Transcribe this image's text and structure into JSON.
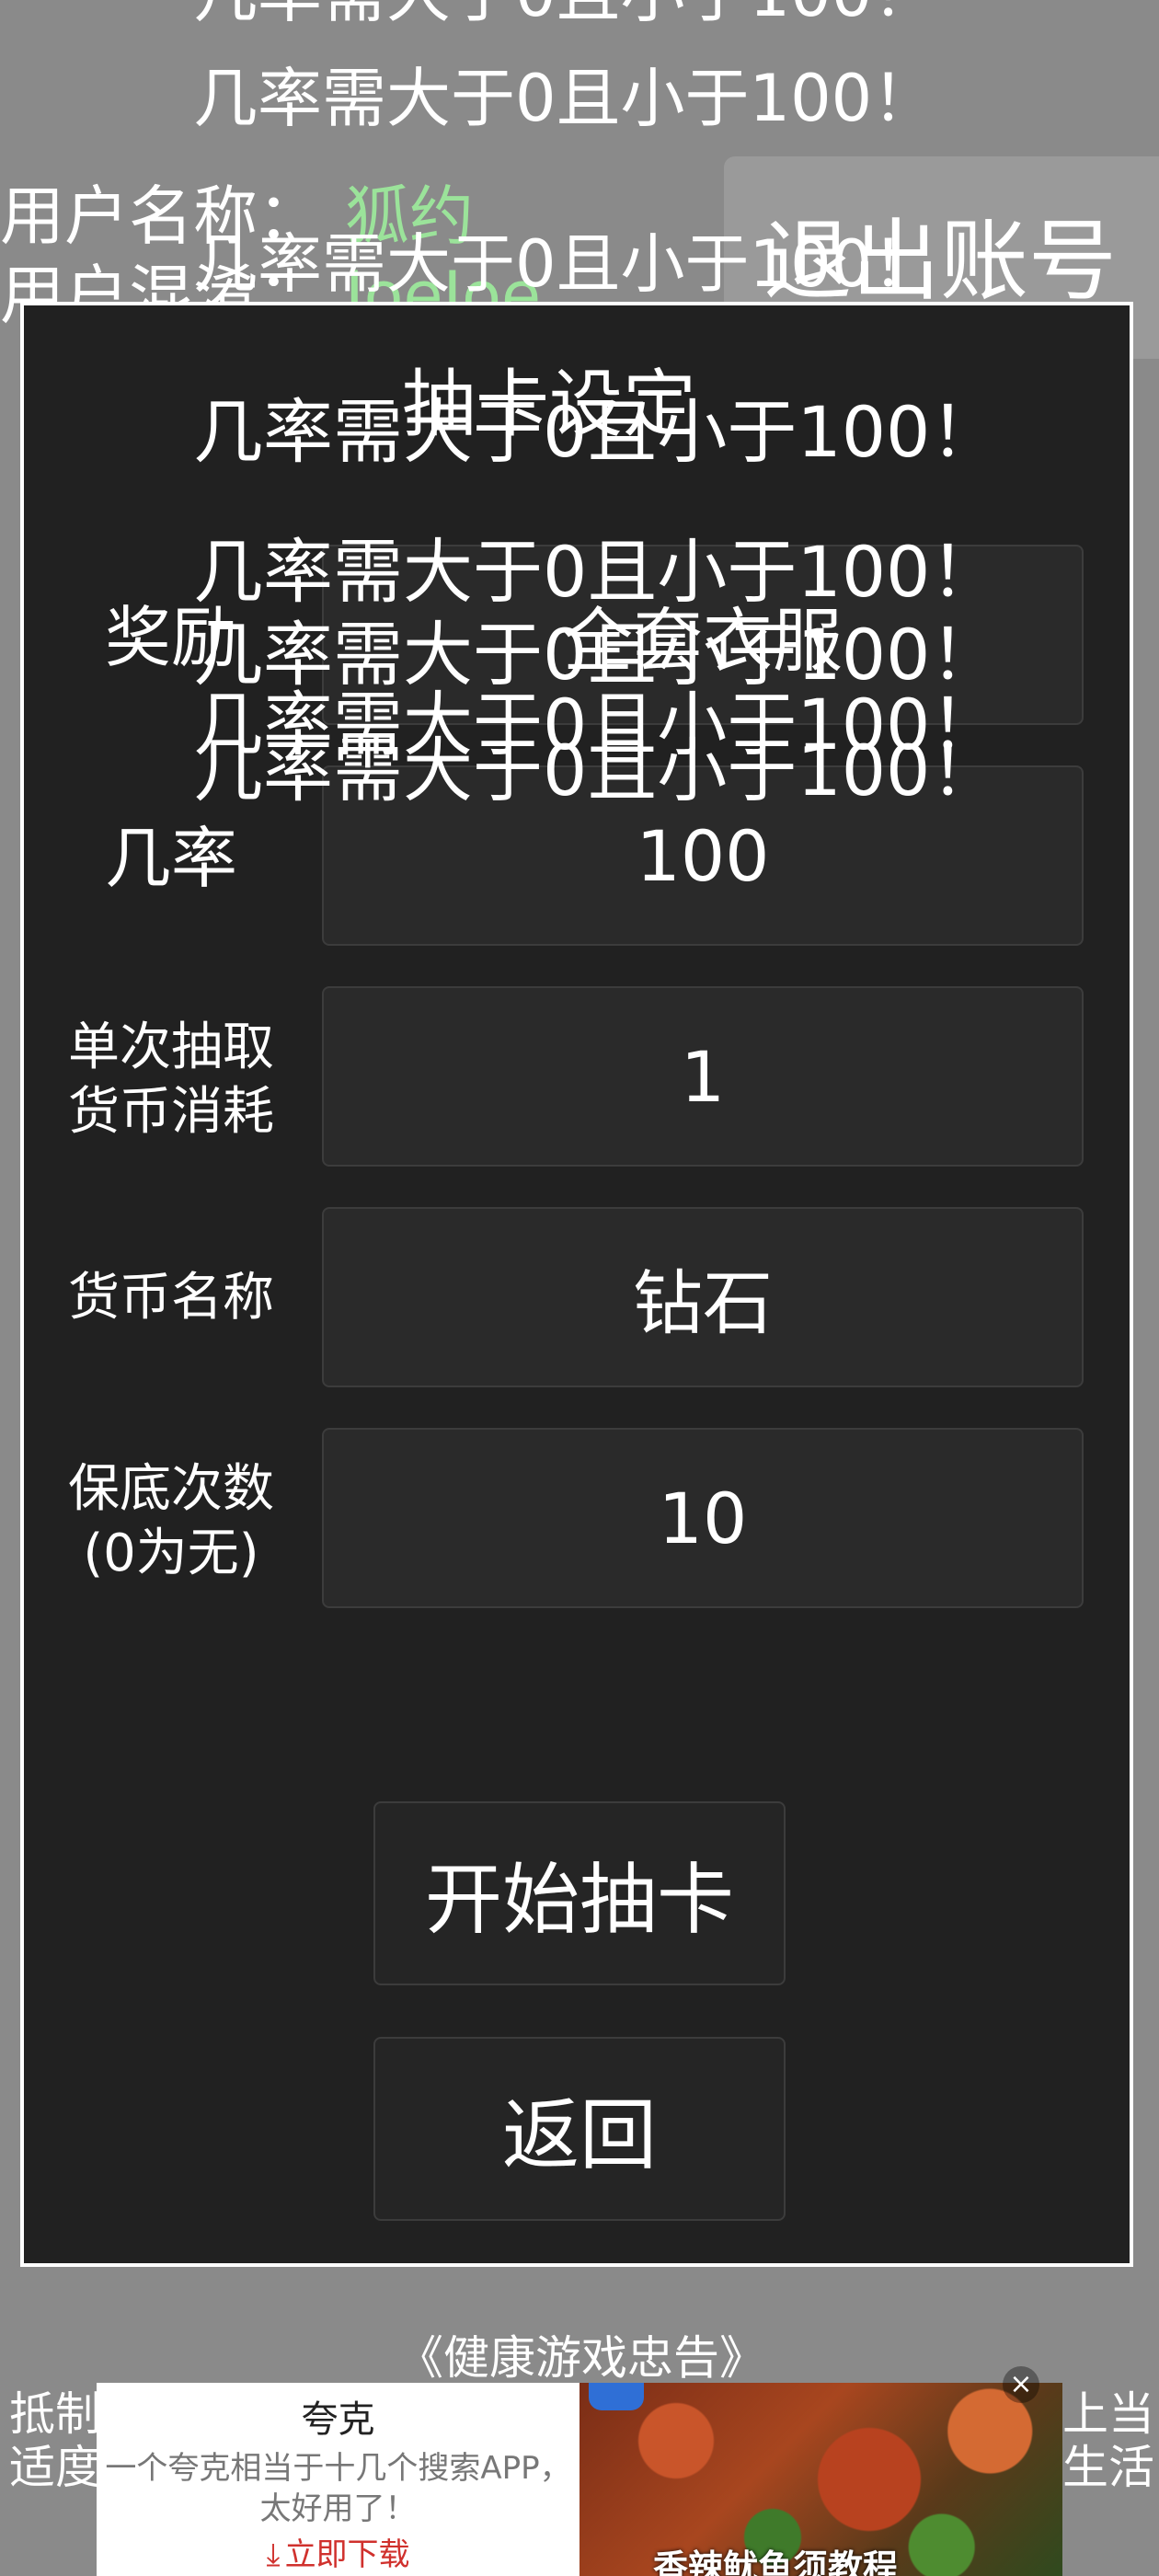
{
  "toast_message": "几率需大于0且小于100！",
  "user": {
    "name_label": "用户名称：",
    "name_value": "狐约",
    "second_label": "用户混淆：",
    "second_value": "JoeJoe"
  },
  "logout_label": "退出账号",
  "dialog": {
    "title": "抽卡设定",
    "fields": [
      {
        "label": "奖励",
        "value": "全套衣服"
      },
      {
        "label": "几率",
        "value": "100"
      },
      {
        "label": "单次抽取\n货币消耗",
        "value": "1"
      },
      {
        "label": "货币名称",
        "value": "钻石"
      },
      {
        "label": "保底次数\n(0为无)",
        "value": "10"
      }
    ],
    "start_button": "开始抽卡",
    "back_button": "返回"
  },
  "footer": {
    "notice_title": "《健康游戏忠告》",
    "left_lines": [
      "抵制",
      "适度"
    ],
    "right_lines": [
      "上当",
      "生活"
    ]
  },
  "ad": {
    "brand": "夸克",
    "desc_line1": "一个夸克相当于十几个搜索APP，",
    "desc_line2": "太好用了！",
    "cta": "立即下载",
    "image_caption": "香辣鱿鱼须教程",
    "close_glyph": "×"
  },
  "icons": {
    "download": "download-icon",
    "close": "close-icon"
  },
  "colors": {
    "background": "#8a8a8a",
    "dialog": "#212121",
    "username": "#9be39a",
    "cta": "#d0312d"
  }
}
